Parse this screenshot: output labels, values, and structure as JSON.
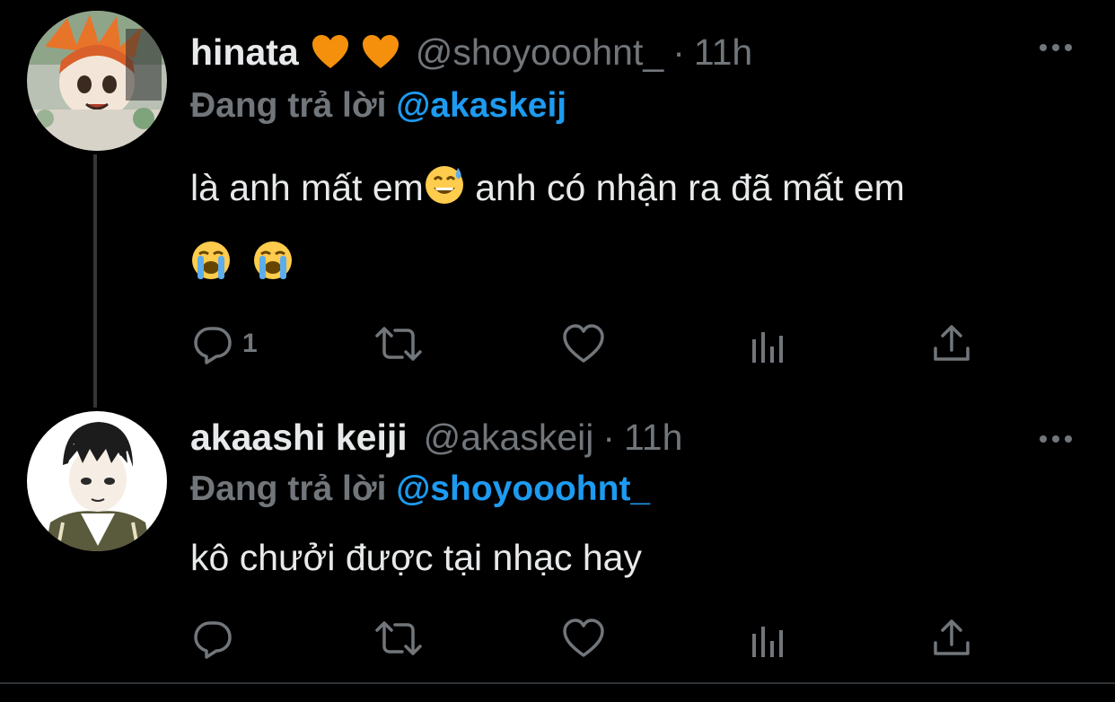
{
  "tweets": [
    {
      "name": "hinata",
      "name_emojis": [
        "orange-heart",
        "orange-heart"
      ],
      "handle": "@shoyooohnt_",
      "dot": "·",
      "time": "11h",
      "reply_prefix": "Đang trả lời",
      "reply_to": "@akaskeij",
      "text_part1": "là anh mất em",
      "text_emoji1": "grinning-face-with-sweat",
      "text_part2": " anh có nhận ra đã mất em",
      "text_line2_emojis": [
        "loudly-crying-face",
        "loudly-crying-face"
      ],
      "reply_count": "1"
    },
    {
      "name": "akaashi keiji",
      "handle": "@akaskeij",
      "dot": "·",
      "time": "11h",
      "reply_prefix": "Đang trả lời",
      "reply_to": "@shoyooohnt_",
      "text": "kô chưởi được tại nhạc hay",
      "reply_count": ""
    }
  ],
  "colors": {
    "background": "#000000",
    "primary_text": "#e7e9ea",
    "secondary_text": "#71767b",
    "mention": "#1d9bf0",
    "heart_orange": "#f4900c"
  },
  "icons": [
    "reply-icon",
    "retweet-icon",
    "like-icon",
    "analytics-icon",
    "share-icon",
    "more-icon"
  ]
}
